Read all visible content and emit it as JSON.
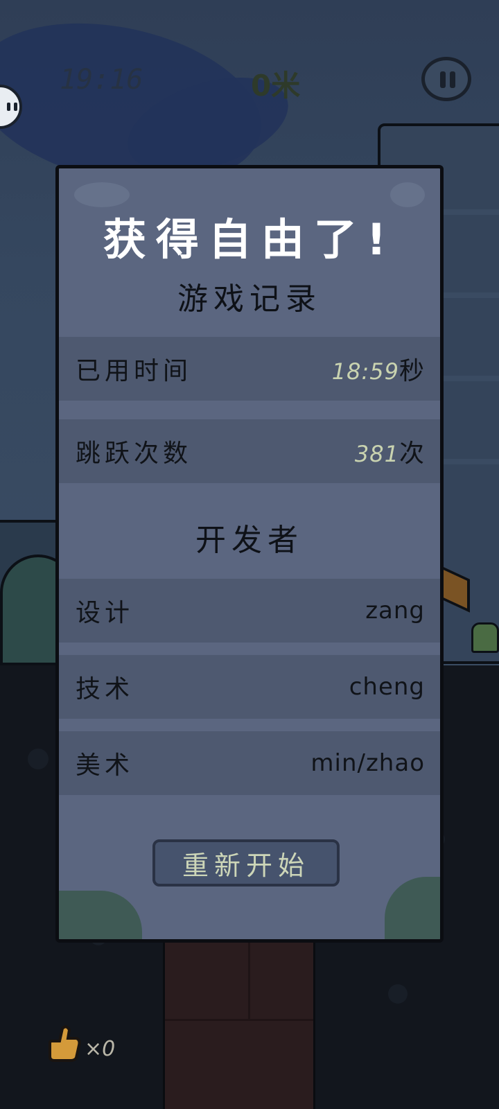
{
  "hud": {
    "time": "19:16",
    "distance": "0米"
  },
  "inventory": {
    "thumb_count": "×0"
  },
  "result_dialog": {
    "title": "获得自由了!",
    "record_heading": "游戏记录",
    "records": [
      {
        "label": "已用时间",
        "value": "18:59",
        "unit": "秒"
      },
      {
        "label": "跳跃次数",
        "value": "381",
        "unit": "次"
      }
    ],
    "developer_heading": "开发者",
    "developers": [
      {
        "role": "设计",
        "name": "zang"
      },
      {
        "role": "技术",
        "name": "cheng"
      },
      {
        "role": "美术",
        "name": "min/zhao"
      }
    ],
    "restart_label": "重新开始"
  },
  "colors": {
    "dialog_bg": "#5b6680",
    "row_bg": "#4e5970",
    "number_highlight": "#c9d3b0",
    "title_text": "#ffffff"
  }
}
